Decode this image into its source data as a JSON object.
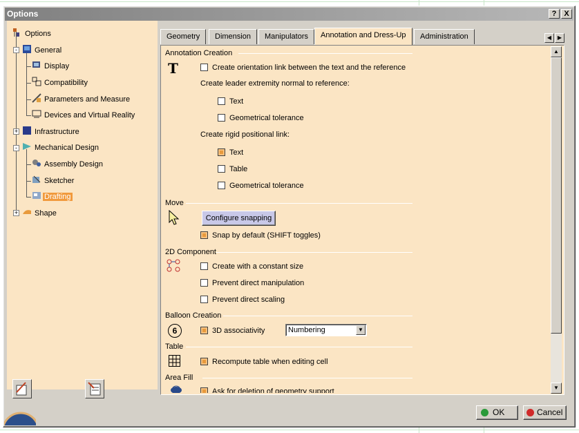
{
  "window": {
    "title": "Options",
    "help_btn": "?",
    "close_btn": "X"
  },
  "tree": {
    "items": [
      {
        "label": "Options"
      },
      {
        "label": "General"
      },
      {
        "label": "Display"
      },
      {
        "label": "Compatibility"
      },
      {
        "label": "Parameters and Measure"
      },
      {
        "label": "Devices and Virtual Reality"
      },
      {
        "label": "Infrastructure"
      },
      {
        "label": "Mechanical Design"
      },
      {
        "label": "Assembly Design"
      },
      {
        "label": "Sketcher"
      },
      {
        "label": "Drafting"
      },
      {
        "label": "Shape"
      }
    ]
  },
  "tabs": [
    {
      "label": "Geometry"
    },
    {
      "label": "Dimension"
    },
    {
      "label": "Manipulators"
    },
    {
      "label": "Annotation and Dress-Up"
    },
    {
      "label": "Administration"
    }
  ],
  "sections": {
    "annotation_creation": {
      "title": "Annotation Creation",
      "orientation_link": "Create orientation link between the text and the reference",
      "leader_label": "Create leader extremity normal to reference:",
      "leader_text": "Text",
      "leader_geo_tol": "Geometrical tolerance",
      "rigid_label": "Create rigid positional link:",
      "rigid_text": "Text",
      "rigid_table": "Table",
      "rigid_geo_tol": "Geometrical tolerance"
    },
    "move": {
      "title": "Move",
      "configure_btn": "Configure snapping",
      "snap_default": "Snap by default (SHIFT toggles)"
    },
    "component_2d": {
      "title": "2D Component",
      "constant_size": "Create with a constant size",
      "prevent_manip": "Prevent direct manipulation",
      "prevent_scaling": "Prevent direct scaling"
    },
    "balloon": {
      "title": "Balloon Creation",
      "assoc_3d": "3D associativity",
      "numbering_value": "Numbering",
      "icon_number": "6"
    },
    "table": {
      "title": "Table",
      "recompute": "Recompute table when editing cell"
    },
    "area_fill": {
      "title": "Area Fill",
      "ask_deletion": "Ask for deletion of geometry support"
    }
  },
  "buttons": {
    "ok": "OK",
    "cancel": "Cancel"
  },
  "colors": {
    "panel_bg": "#fbe5c4",
    "selection": "#f19a3d",
    "checked": "#e89a3c"
  }
}
